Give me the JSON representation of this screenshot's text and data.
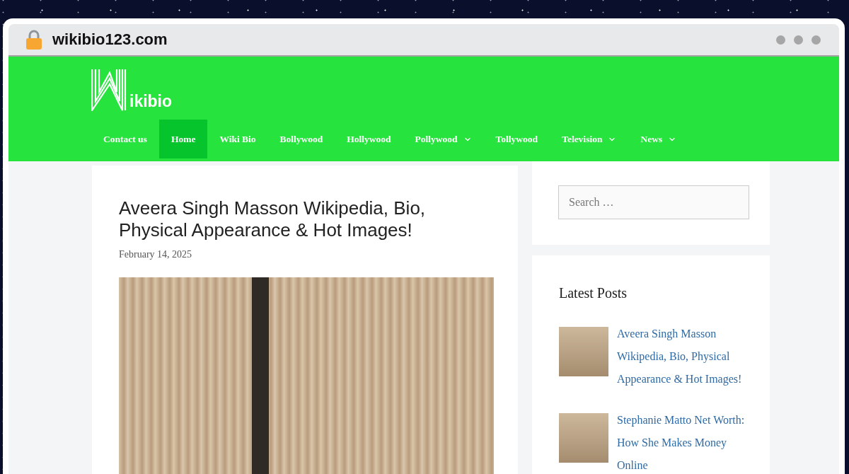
{
  "browser": {
    "url": "wikibio123.com"
  },
  "header": {
    "logo_text": "ikibio",
    "nav": [
      {
        "label": "Contact us",
        "selected": false,
        "has_submenu": false
      },
      {
        "label": "Home",
        "selected": true,
        "has_submenu": false
      },
      {
        "label": "Wiki Bio",
        "selected": false,
        "has_submenu": false
      },
      {
        "label": "Bollywood",
        "selected": false,
        "has_submenu": false
      },
      {
        "label": "Hollywood",
        "selected": false,
        "has_submenu": false
      },
      {
        "label": "Pollywood",
        "selected": false,
        "has_submenu": true
      },
      {
        "label": "Tollywood",
        "selected": false,
        "has_submenu": false
      },
      {
        "label": "Television",
        "selected": false,
        "has_submenu": true
      },
      {
        "label": "News",
        "selected": false,
        "has_submenu": true
      }
    ]
  },
  "article": {
    "title": "Aveera Singh Masson Wikipedia, Bio, Physical Appearance & Hot Images!",
    "date": "February 14, 2025"
  },
  "sidebar": {
    "search": {
      "placeholder": "Search …"
    },
    "latest_posts": {
      "heading": "Latest Posts",
      "posts": [
        {
          "title": "Aveera Singh Masson Wikipedia, Bio, Physical Appearance & Hot Images!"
        },
        {
          "title": "Stephanie Matto Net Worth: How She Makes Money Online"
        }
      ]
    }
  }
}
